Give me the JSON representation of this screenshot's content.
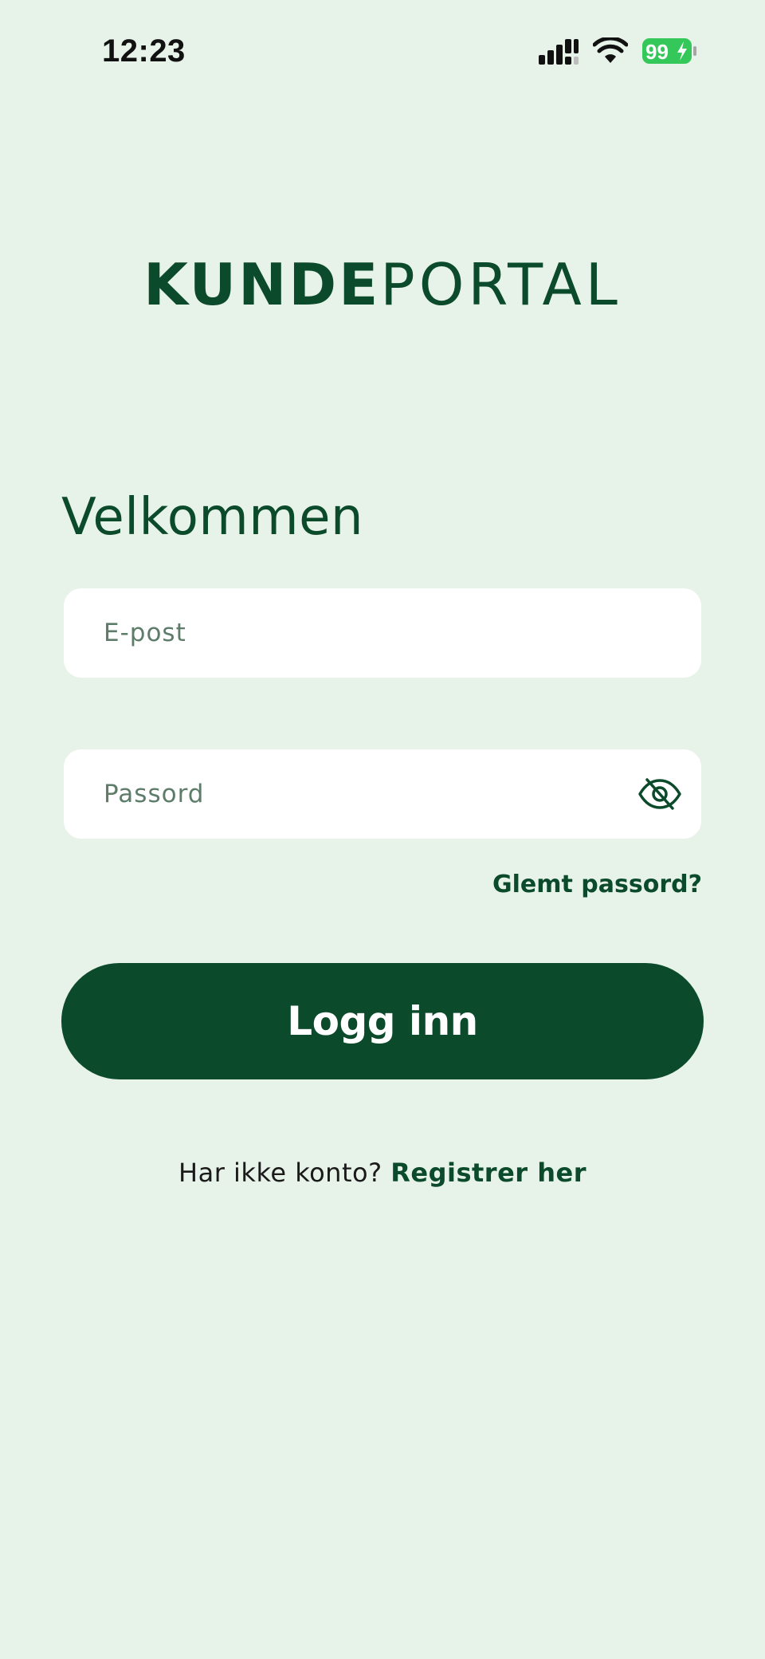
{
  "status_bar": {
    "time": "12:23",
    "battery_level": "99",
    "icons": [
      "signal-icon",
      "wifi-icon",
      "battery-charging-icon"
    ]
  },
  "logo": {
    "bold_part": "KUNDE",
    "light_part": "PORTAL"
  },
  "welcome": {
    "title": "Velkommen"
  },
  "form": {
    "email_placeholder": "E-post",
    "email_value": "",
    "password_placeholder": "Passord",
    "password_value": "",
    "password_toggle_icon": "eye-off-icon",
    "forgot_password_label": "Glemt passord?",
    "login_label": "Logg inn"
  },
  "register": {
    "prompt": "Har ikke konto? ",
    "link_label": "Registrer her"
  },
  "colors": {
    "background": "#E7F2E9",
    "brand_green": "#0B4A2A",
    "battery_green": "#34C759",
    "field_background": "#FFFFFF"
  }
}
